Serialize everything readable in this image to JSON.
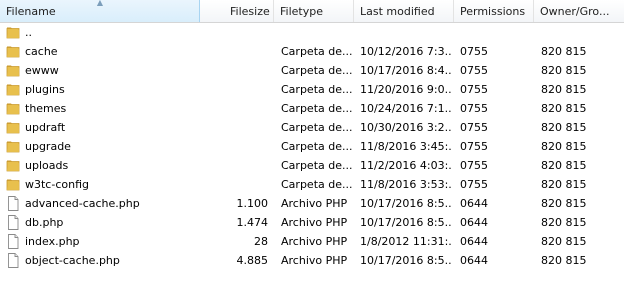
{
  "columns": [
    {
      "label": "Filename"
    },
    {
      "label": "Filesize"
    },
    {
      "label": "Filetype"
    },
    {
      "label": "Last modified"
    },
    {
      "label": "Permissions"
    },
    {
      "label": "Owner/Gro..."
    }
  ],
  "rows": [
    {
      "name": "..",
      "size": "",
      "type": "",
      "modified": "",
      "permissions": "",
      "owner": "",
      "icon": "folder-icon"
    },
    {
      "name": "cache",
      "size": "",
      "type": "Carpeta de...",
      "modified": "10/12/2016 7:3...",
      "permissions": "0755",
      "owner": "820 815",
      "icon": "folder-icon"
    },
    {
      "name": "ewww",
      "size": "",
      "type": "Carpeta de...",
      "modified": "10/17/2016 8:4...",
      "permissions": "0755",
      "owner": "820 815",
      "icon": "folder-icon"
    },
    {
      "name": "plugins",
      "size": "",
      "type": "Carpeta de...",
      "modified": "11/20/2016 9:0...",
      "permissions": "0755",
      "owner": "820 815",
      "icon": "folder-icon"
    },
    {
      "name": "themes",
      "size": "",
      "type": "Carpeta de...",
      "modified": "10/24/2016 7:1...",
      "permissions": "0755",
      "owner": "820 815",
      "icon": "folder-icon"
    },
    {
      "name": "updraft",
      "size": "",
      "type": "Carpeta de...",
      "modified": "10/30/2016 3:2...",
      "permissions": "0755",
      "owner": "820 815",
      "icon": "folder-icon"
    },
    {
      "name": "upgrade",
      "size": "",
      "type": "Carpeta de...",
      "modified": "11/8/2016 3:45:...",
      "permissions": "0755",
      "owner": "820 815",
      "icon": "folder-icon"
    },
    {
      "name": "uploads",
      "size": "",
      "type": "Carpeta de...",
      "modified": "11/2/2016 4:03:...",
      "permissions": "0755",
      "owner": "820 815",
      "icon": "folder-icon"
    },
    {
      "name": "w3tc-config",
      "size": "",
      "type": "Carpeta de...",
      "modified": "11/8/2016 3:53:...",
      "permissions": "0755",
      "owner": "820 815",
      "icon": "folder-icon"
    },
    {
      "name": "advanced-cache.php",
      "size": "1.100",
      "type": "Archivo PHP",
      "modified": "10/17/2016 8:5...",
      "permissions": "0644",
      "owner": "820 815",
      "icon": "file-icon"
    },
    {
      "name": "db.php",
      "size": "1.474",
      "type": "Archivo PHP",
      "modified": "10/17/2016 8:5...",
      "permissions": "0644",
      "owner": "820 815",
      "icon": "file-icon"
    },
    {
      "name": "index.php",
      "size": "28",
      "type": "Archivo PHP",
      "modified": "1/8/2012 11:31:...",
      "permissions": "0644",
      "owner": "820 815",
      "icon": "file-icon"
    },
    {
      "name": "object-cache.php",
      "size": "4.885",
      "type": "Archivo PHP",
      "modified": "10/17/2016 8:5...",
      "permissions": "0644",
      "owner": "820 815",
      "icon": "file-icon"
    }
  ],
  "colors": {
    "folder": "#e8bf4d",
    "folder_dark": "#c99a2e",
    "header_sorted": "#d9eefb"
  }
}
